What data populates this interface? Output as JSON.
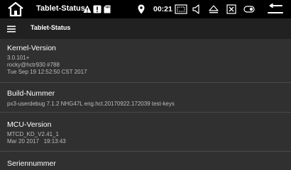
{
  "statusbar": {
    "title": "Tablet-Status",
    "clock": "00:21",
    "icons": [
      "home-icon",
      "warning-icon",
      "alert-icon",
      "sd-card-icon",
      "location-icon",
      "screenshot-icon",
      "volume-icon",
      "eject-icon",
      "close-box-icon",
      "toggle-icon",
      "back-icon"
    ]
  },
  "toolbar": {
    "title": "Tablet-Status",
    "menu_icon": "menu-icon"
  },
  "items": [
    {
      "title": "Kernel-Version",
      "summary": "3.0.101+\nrocky@hctr930 #788\nTue Sep 19 12:52:50 CST 2017"
    },
    {
      "title": "Build-Nummer",
      "summary": "px3-userdebug 7.1.2 NHG47L eng.hct.20170922.172039 test-keys"
    },
    {
      "title": "MCU-Version",
      "summary": "MTCD_KD_V2.41_1\nMar 20 2017   19:13:43"
    },
    {
      "title": "Seriennummer",
      "summary": ""
    }
  ],
  "colors": {
    "statusbar_bg": "#000000",
    "toolbar_bg": "#212121",
    "content_bg": "#303030",
    "summary_text": "#bdbdbd",
    "divider": "#4a4a4a"
  }
}
